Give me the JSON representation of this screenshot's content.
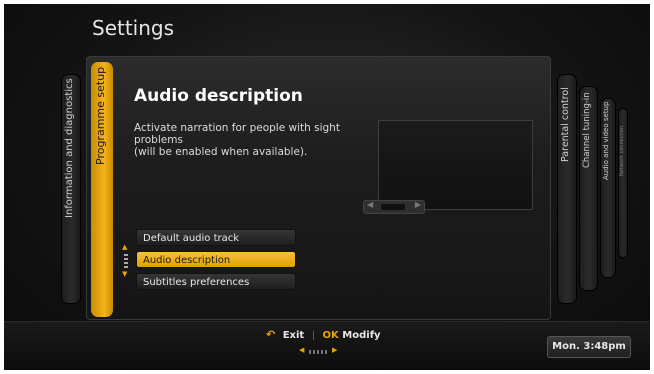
{
  "page_title": "Settings",
  "left_tabs": {
    "info": "Information and diagnostics",
    "active": "Programme setup"
  },
  "right_tabs": {
    "parental": "Parental control",
    "channel": "Channel tuning-in",
    "audio_video": "Audio and video setup",
    "network": "Network connection"
  },
  "main": {
    "heading": "Audio description",
    "description_lines": [
      "Activate narration for people with sight",
      "problems",
      "(will be enabled when available)."
    ]
  },
  "menu": {
    "items": [
      {
        "label": "Default audio track",
        "selected": false
      },
      {
        "label": "Audio description",
        "selected": true
      },
      {
        "label": "Subtitles preferences",
        "selected": false
      }
    ]
  },
  "footer": {
    "exit_label": "Exit",
    "ok_label": "OK",
    "modify_label": "Modify",
    "clock": "Mon. 3:48pm"
  },
  "colors": {
    "accent": "#f0ac10",
    "selected_item": "#f0b020",
    "background": "#141414"
  }
}
